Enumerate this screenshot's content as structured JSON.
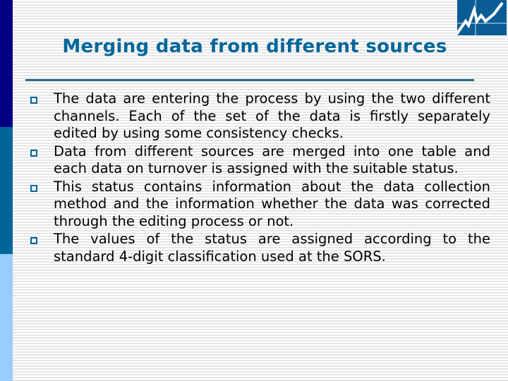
{
  "slide": {
    "title": "Merging data from different sources",
    "accent_color": "#006699",
    "sidebar_colors": [
      "#000080",
      "#006699",
      "#99ccff"
    ],
    "logo": "zigzag-chart-logo",
    "bullet_icon": "hollow-square-bullet",
    "bullets": [
      {
        "text": "The data are entering the process by using the two different channels. Each of the set of the data is firstly separately edited by using some consistency checks."
      },
      {
        "text": "Data from different sources are merged into one table and each data on turnover is assigned with the suitable status."
      },
      {
        "text": "This status contains information about the data collection method and the information whether the data was corrected through the editing process or not."
      },
      {
        "text": "The values of the status are assigned according to the standard 4-digit classification used at the SORS."
      }
    ]
  }
}
